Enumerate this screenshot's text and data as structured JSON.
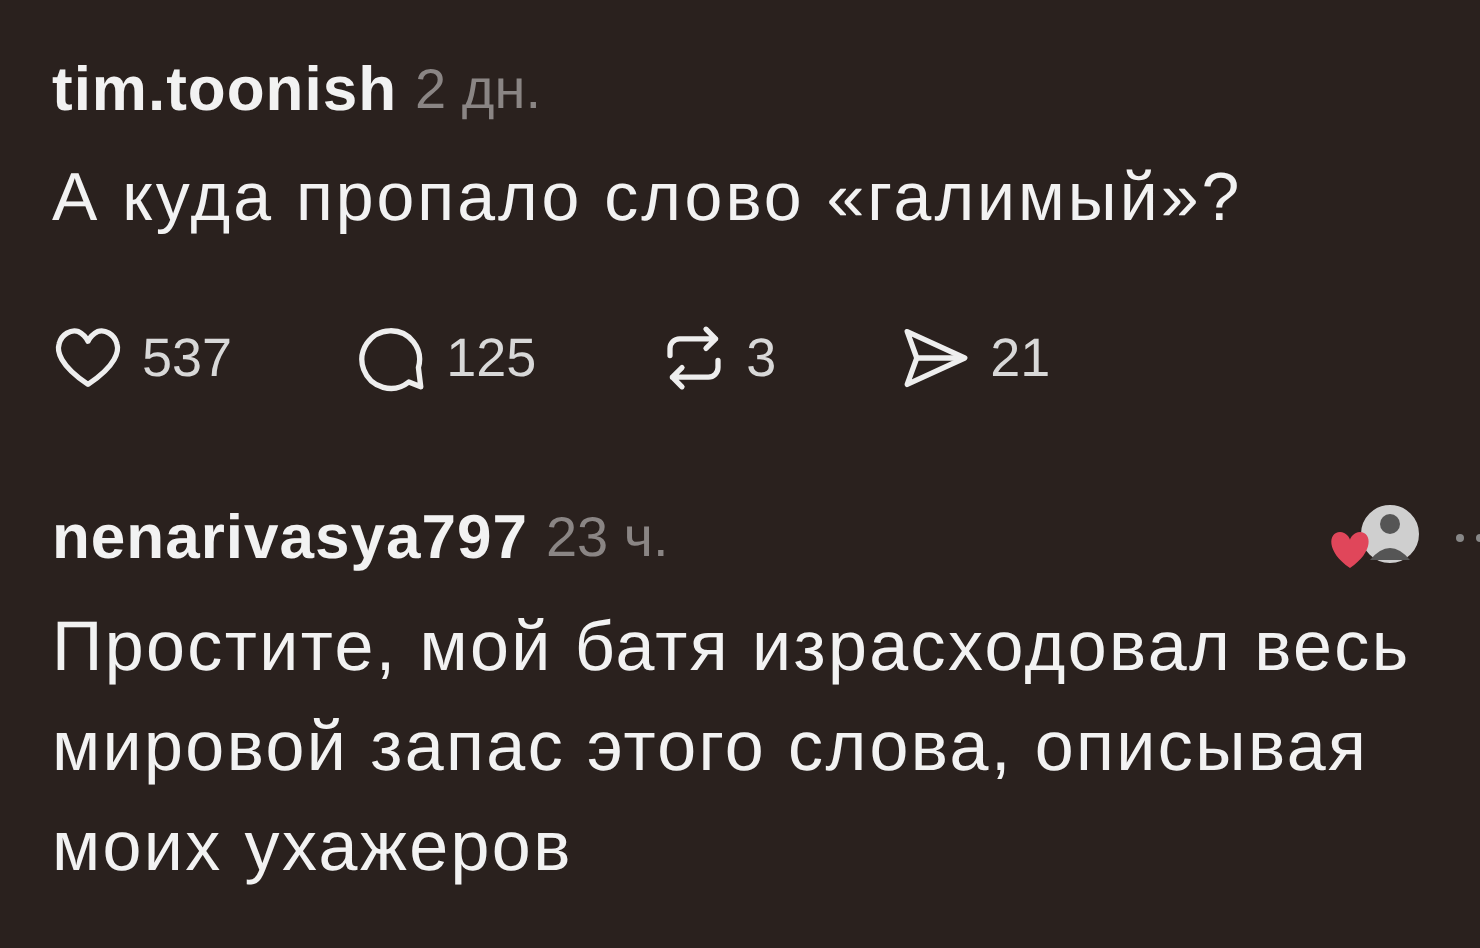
{
  "posts": [
    {
      "username": "tim.toonish",
      "time": "2 дн.",
      "text": "А куда пропало слово «галимый»?",
      "actions": [
        {
          "kind": "like",
          "count": "537"
        },
        {
          "kind": "reply",
          "count": "125"
        },
        {
          "kind": "repost",
          "count": "3"
        },
        {
          "kind": "share",
          "count": "21"
        }
      ]
    },
    {
      "username": "nenarivasya797",
      "time": "23 ч.",
      "text": "Простите, мой батя израсходовал весь мировой запас этого слова, описывая моих ухажеров",
      "author_liked": true
    }
  ]
}
